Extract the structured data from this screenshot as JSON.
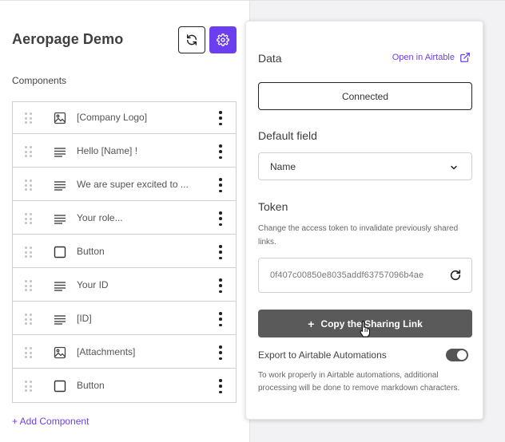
{
  "app": {
    "title": "Aeropage Demo"
  },
  "header": {
    "refresh_icon": "refresh-icon",
    "settings_icon": "gear-icon"
  },
  "components": {
    "label": "Components",
    "items": [
      {
        "type_icon": "image-icon",
        "label": "[Company Logo]"
      },
      {
        "type_icon": "text-lines-icon",
        "label": "Hello [Name] !"
      },
      {
        "type_icon": "text-lines-icon",
        "label": "We are super excited to ..."
      },
      {
        "type_icon": "text-lines-icon",
        "label": "Your role..."
      },
      {
        "type_icon": "checkbox-square-icon",
        "label": "Button"
      },
      {
        "type_icon": "text-lines-icon",
        "label": "Your ID"
      },
      {
        "type_icon": "text-lines-icon",
        "label": "[ID]"
      },
      {
        "type_icon": "image-icon",
        "label": "[Attachments]"
      },
      {
        "type_icon": "checkbox-square-icon",
        "label": "Button"
      }
    ],
    "add_label": "+ Add Component"
  },
  "settings_popover": {
    "data_heading": "Data",
    "open_link": "Open in Airtable",
    "connected_label": "Connected",
    "default_field_heading": "Default field",
    "default_field_value": "Name",
    "token_heading": "Token",
    "token_help": "Change the access token to invalidate previously shared links.",
    "token_value": "0f407c00850e8035addf63757096b4ae",
    "copy_button": "Copy the Sharing Link",
    "export_label": "Export to Airtable Automations",
    "export_enabled": true,
    "export_help": "To work properly in Airtable automations, additional processing will be done to remove markdown characters."
  },
  "colors": {
    "accent": "#6b3ff0",
    "dark_button": "#5a5a5a",
    "border": "#cfcfcf"
  }
}
